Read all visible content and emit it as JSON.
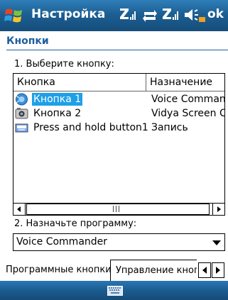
{
  "titlebar": {
    "title": "Настройка",
    "ok_label": "ok"
  },
  "page": {
    "heading": "Кнопки",
    "step1_label": "1. Выберите кнопку:",
    "step2_label": "2. Назначьте программу:"
  },
  "list": {
    "columns": [
      "Кнопка",
      "Назначение"
    ],
    "rows": [
      {
        "name": "Кнопка 1",
        "assignment": "Voice Commander",
        "icon": "voice-button-icon",
        "selected": true
      },
      {
        "name": "Кнопка 2",
        "assignment": "Vidya Screen Capture",
        "icon": "camera-button-icon",
        "selected": false
      },
      {
        "name": "Press and hold button1",
        "assignment": "Запись",
        "icon": "keyboard-button-icon",
        "selected": false
      }
    ]
  },
  "program_select": {
    "value": "Voice Commander"
  },
  "tabs": [
    {
      "label": "Программные кнопки",
      "active": true
    },
    {
      "label": "Управление кнопками",
      "active": false
    }
  ],
  "colors": {
    "titlebar": "#1c5f93",
    "heading": "#1e5fa0",
    "selection": "#1ea0e8"
  }
}
